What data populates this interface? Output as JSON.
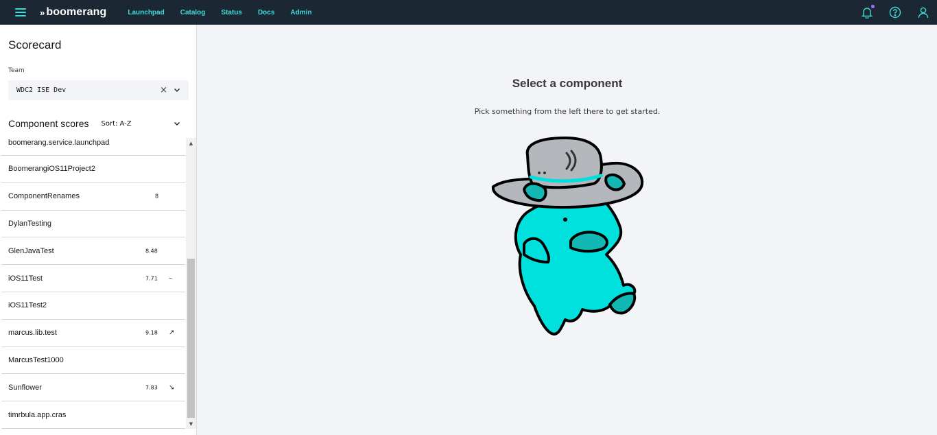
{
  "header": {
    "brand": "boomerang",
    "nav": [
      "Launchpad",
      "Catalog",
      "Status",
      "Docs",
      "Admin"
    ],
    "icons": [
      "menu-icon",
      "bell-icon",
      "help-icon",
      "user-icon"
    ],
    "accent_color": "#3ddbd9",
    "notification_dot_color": "#a56eff"
  },
  "sidebar": {
    "title": "Scorecard",
    "team_label": "Team",
    "team_value": "WDC2 ISE Dev",
    "scores_title": "Component scores",
    "sort_label": "Sort: A-Z",
    "components": [
      {
        "name": "boomerang.service.launchpad",
        "score": "",
        "trend": ""
      },
      {
        "name": "BoomerangiOS11Project2",
        "score": "",
        "trend": ""
      },
      {
        "name": "ComponentRenames",
        "score": "8",
        "trend": ""
      },
      {
        "name": "DylanTesting",
        "score": "",
        "trend": ""
      },
      {
        "name": "GlenJavaTest",
        "score": "8.48",
        "trend": ""
      },
      {
        "name": "iOS11Test",
        "score": "7.71",
        "trend": "–"
      },
      {
        "name": "iOS11Test2",
        "score": "",
        "trend": ""
      },
      {
        "name": "marcus.lib.test",
        "score": "9.18",
        "trend": "↗"
      },
      {
        "name": "MarcusTest1000",
        "score": "",
        "trend": ""
      },
      {
        "name": "Sunflower",
        "score": "7.83",
        "trend": "↘"
      },
      {
        "name": "timrbula.app.cras",
        "score": "",
        "trend": ""
      }
    ]
  },
  "main": {
    "title": "Select a component",
    "subtitle": "Pick something from the left there to get started."
  }
}
